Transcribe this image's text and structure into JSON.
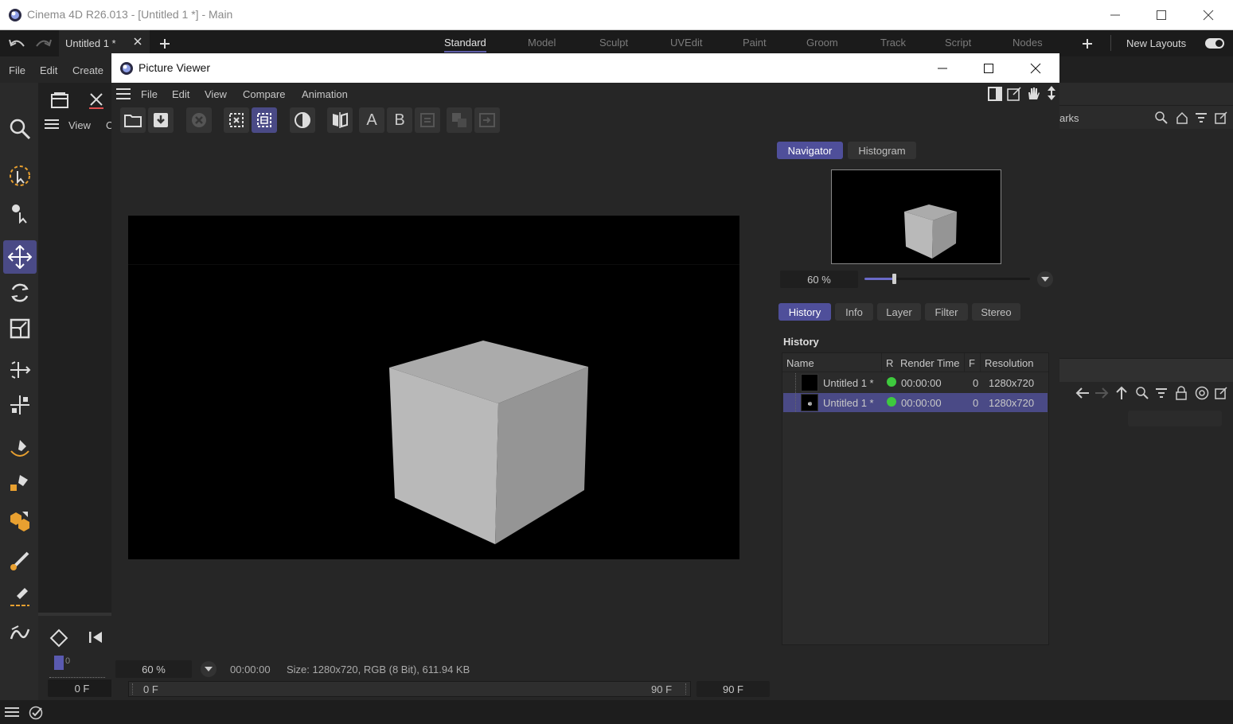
{
  "app": {
    "title": "Cinema 4D R26.013 - [Untitled 1 *] - Main"
  },
  "doc_tab": {
    "label": "Untitled 1 *"
  },
  "layouts": [
    "Standard",
    "Model",
    "Sculpt",
    "UVEdit",
    "Paint",
    "Groom",
    "Track",
    "Script",
    "Nodes"
  ],
  "new_layouts": "New Layouts",
  "main_menu": {
    "file": "File",
    "edit": "Edit",
    "create": "Create"
  },
  "viewport_menu": {
    "view": "View",
    "c": "C"
  },
  "picture_viewer": {
    "title": "Picture Viewer",
    "menu": {
      "file": "File",
      "edit": "Edit",
      "view": "View",
      "compare": "Compare",
      "animation": "Animation"
    },
    "tb_a": "A",
    "tb_b": "B",
    "side_tabs": {
      "navigator": "Navigator",
      "histogram": "Histogram"
    },
    "zoom": "60 %",
    "zoom_slider_fraction": 0.18,
    "info_tabs": {
      "history": "History",
      "info": "Info",
      "layer": "Layer",
      "filter": "Filter",
      "stereo": "Stereo"
    },
    "history_title": "History",
    "history_columns": {
      "name": "Name",
      "r": "R",
      "render_time": "Render Time",
      "f": "F",
      "resolution": "Resolution"
    },
    "history_rows": [
      {
        "name": "Untitled 1 *",
        "time": "00:00:00",
        "frame": "0",
        "res": "1280x720",
        "status_color": "#3ec93e"
      },
      {
        "name": "Untitled 1 *",
        "time": "00:00:00",
        "frame": "0",
        "res": "1280x720",
        "status_color": "#3ec93e"
      }
    ],
    "status": {
      "zoom": "60 %",
      "time": "00:00:00",
      "size": "Size: 1280x720, RGB (8 Bit), 611.94 KB"
    },
    "frame_start": "0 F",
    "frame_end_inner": "90 F",
    "frame_end": "90 F"
  },
  "right_dock": {
    "bookmarks_partial": "arks"
  },
  "timeline": {
    "marker": "0",
    "frame": "0 F"
  },
  "colors": {
    "accent": "#4a4a86",
    "tab_active": "#4f4f9a",
    "status_dot": "#3ec93e"
  }
}
